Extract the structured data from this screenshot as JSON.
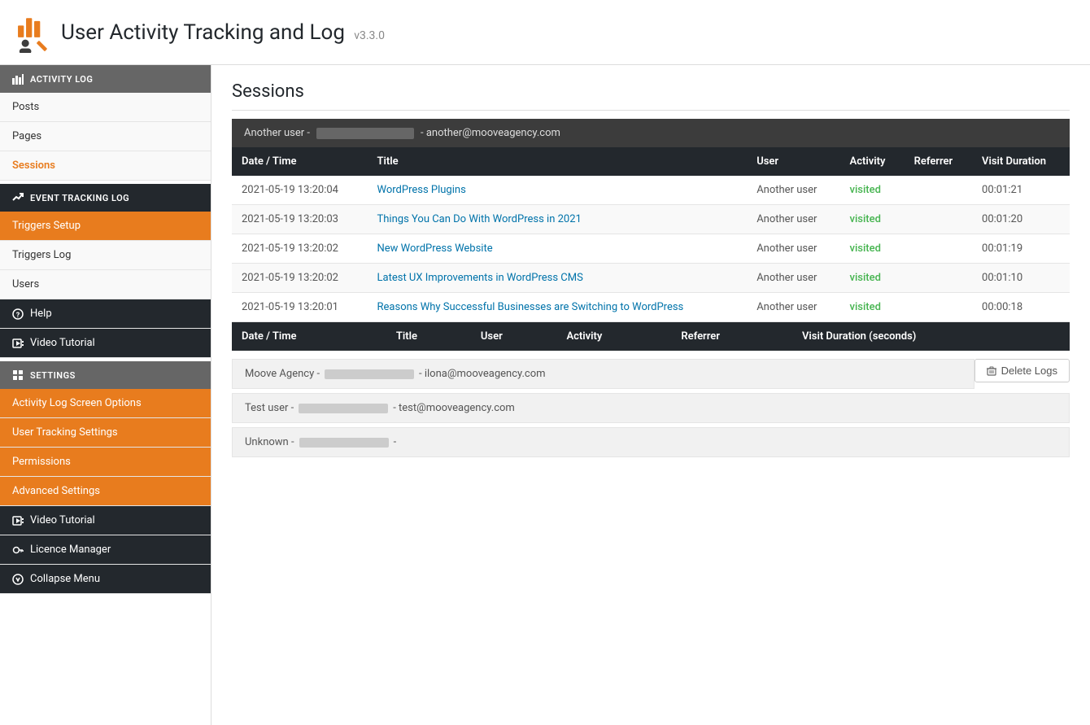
{
  "app": {
    "title": "User Activity Tracking and Log",
    "version": "v3.3.0"
  },
  "sidebar": {
    "sections": [
      {
        "id": "activity-log",
        "label": "ACTIVITY LOG",
        "icon": "chart-icon",
        "items": [
          {
            "id": "posts",
            "label": "Posts",
            "state": "normal"
          },
          {
            "id": "pages",
            "label": "Pages",
            "state": "normal"
          },
          {
            "id": "sessions",
            "label": "Sessions",
            "state": "active-link"
          }
        ]
      },
      {
        "id": "event-tracking-log",
        "label": "EVENT TRACKING LOG",
        "icon": "trending-icon",
        "items": [
          {
            "id": "triggers-setup",
            "label": "Triggers Setup",
            "state": "active-orange"
          },
          {
            "id": "triggers-log",
            "label": "Triggers Log",
            "state": "normal"
          },
          {
            "id": "users",
            "label": "Users",
            "state": "normal"
          }
        ]
      },
      {
        "id": "help-item",
        "label": "Help",
        "icon": "help-icon",
        "dark": true
      },
      {
        "id": "video-tutorial-1",
        "label": "Video Tutorial",
        "icon": "video-icon",
        "dark": true
      },
      {
        "id": "settings",
        "label": "SETTINGS",
        "icon": "grid-icon",
        "items": [
          {
            "id": "activity-log-screen-options",
            "label": "Activity Log Screen Options",
            "state": "active-orange"
          },
          {
            "id": "user-tracking-settings",
            "label": "User Tracking Settings",
            "state": "active-orange"
          },
          {
            "id": "permissions",
            "label": "Permissions",
            "state": "active-orange"
          },
          {
            "id": "advanced-settings",
            "label": "Advanced Settings",
            "state": "active-orange"
          }
        ]
      },
      {
        "id": "video-tutorial-2",
        "label": "Video Tutorial",
        "icon": "video-icon",
        "dark": true
      },
      {
        "id": "licence-manager",
        "label": "Licence Manager",
        "icon": "key-icon",
        "dark": true
      },
      {
        "id": "collapse-menu",
        "label": "Collapse Menu",
        "icon": "arrow-icon",
        "dark": true
      }
    ]
  },
  "main": {
    "page_title": "Sessions",
    "user_bar": {
      "prefix": "Another user -",
      "blurred": true,
      "email": "- another@mooveagency.com"
    },
    "table": {
      "headers": [
        "Date / Time",
        "Title",
        "User",
        "Activity",
        "Referrer",
        "Visit Duration"
      ],
      "rows": [
        {
          "datetime": "2021-05-19 13:20:04",
          "title": "WordPress Plugins",
          "user": "Another user",
          "activity": "visited",
          "referrer": "",
          "duration": "00:01:21"
        },
        {
          "datetime": "2021-05-19 13:20:03",
          "title": "Things You Can Do With WordPress in 2021",
          "user": "Another user",
          "activity": "visited",
          "referrer": "",
          "duration": "00:01:20"
        },
        {
          "datetime": "2021-05-19 13:20:02",
          "title": "New WordPress Website",
          "user": "Another user",
          "activity": "visited",
          "referrer": "",
          "duration": "00:01:19"
        },
        {
          "datetime": "2021-05-19 13:20:02",
          "title": "Latest UX Improvements in WordPress CMS",
          "user": "Another user",
          "activity": "visited",
          "referrer": "",
          "duration": "00:01:10"
        },
        {
          "datetime": "2021-05-19 13:20:01",
          "title": "Reasons Why Successful Businesses are Switching to WordPress",
          "user": "Another user",
          "activity": "visited",
          "referrer": "",
          "duration": "00:00:18"
        }
      ],
      "footer_headers": [
        "Date / Time",
        "Title",
        "User",
        "Activity",
        "Referrer",
        "Visit Duration (seconds)"
      ]
    },
    "delete_logs_label": "Delete Logs",
    "bottom_users": [
      {
        "name": "Moove Agency",
        "email": "ilona@mooveagency.com"
      },
      {
        "name": "Test user",
        "email": "test@mooveagency.com"
      },
      {
        "name": "Unknown",
        "email": ""
      }
    ]
  }
}
